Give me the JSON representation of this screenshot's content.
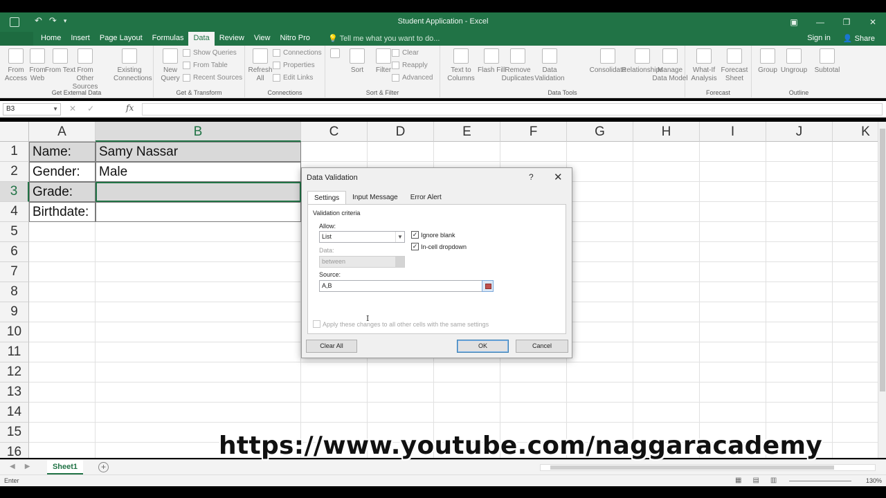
{
  "window": {
    "title": "Student Application - Excel",
    "minimize": "—",
    "maximize": "❐",
    "close": "✕",
    "ribbon_options": "▣"
  },
  "qat": {
    "undo": "↶",
    "redo": "↷",
    "customize": "▾"
  },
  "ribbon_tabs": [
    "Home",
    "Insert",
    "Page Layout",
    "Formulas",
    "Data",
    "Review",
    "View",
    "Nitro Pro"
  ],
  "active_tab": "Data",
  "tell_me": "Tell me what you want to do...",
  "sign_in": "Sign in",
  "share": "Share",
  "ribbon": {
    "get_external_data": {
      "label": "Get External Data",
      "buttons": [
        "From Access",
        "From Web",
        "From Text",
        "From Other Sources",
        "Existing Connections"
      ]
    },
    "get_transform": {
      "label": "Get & Transform",
      "new_query": "New Query",
      "small": [
        "Show Queries",
        "From Table",
        "Recent Sources"
      ]
    },
    "connections": {
      "label": "Connections",
      "refresh_all": "Refresh All",
      "small": [
        "Connections",
        "Properties",
        "Edit Links"
      ]
    },
    "sort_filter": {
      "label": "Sort & Filter",
      "sort": "Sort",
      "filter": "Filter",
      "small": [
        "Clear",
        "Reapply",
        "Advanced"
      ]
    },
    "data_tools": {
      "label": "Data Tools",
      "buttons": [
        "Text to Columns",
        "Flash Fill",
        "Remove Duplicates",
        "Data Validation",
        "Consolidate",
        "Relationships",
        "Manage Data Model"
      ]
    },
    "forecast": {
      "label": "Forecast",
      "buttons": [
        "What-If Analysis",
        "Forecast Sheet"
      ]
    },
    "outline": {
      "label": "Outline",
      "buttons": [
        "Group",
        "Ungroup",
        "Subtotal"
      ]
    }
  },
  "formula_bar": {
    "name_box": "B3",
    "fx": "fx",
    "cancel": "✕",
    "enter": "✓",
    "value": ""
  },
  "columns": [
    "A",
    "B",
    "C",
    "D",
    "E",
    "F",
    "G",
    "H",
    "I",
    "J",
    "K"
  ],
  "rows": [
    "1",
    "2",
    "3",
    "4",
    "5",
    "6",
    "7",
    "8",
    "9",
    "10",
    "11",
    "12",
    "13",
    "14",
    "15",
    "16"
  ],
  "cells": {
    "A1": "Name:",
    "B1": "Samy Nassar",
    "A2": "Gender:",
    "B2": "Male",
    "A3": "Grade:",
    "B3": "",
    "A4": "Birthdate:",
    "B4": ""
  },
  "sheet_tabs": [
    "Sheet1"
  ],
  "status": {
    "mode": "Enter",
    "zoom": "130%"
  },
  "watermark": "https://www.youtube.com/naggaracademy",
  "dialog": {
    "title": "Data Validation",
    "help": "?",
    "close": "✕",
    "tabs": [
      "Settings",
      "Input Message",
      "Error Alert"
    ],
    "active_tab": "Settings",
    "validation_criteria": "Validation criteria",
    "allow_label": "Allow:",
    "allow_value": "List",
    "data_label": "Data:",
    "data_value": "between",
    "ignore_blank": "Ignore blank",
    "ignore_blank_checked": true,
    "in_cell_dropdown": "In-cell dropdown",
    "in_cell_dropdown_checked": true,
    "source_label": "Source:",
    "source_value": "A,B",
    "apply_all": "Apply these changes to all other cells with the same settings",
    "clear_all": "Clear All",
    "ok": "OK",
    "cancel": "Cancel"
  }
}
